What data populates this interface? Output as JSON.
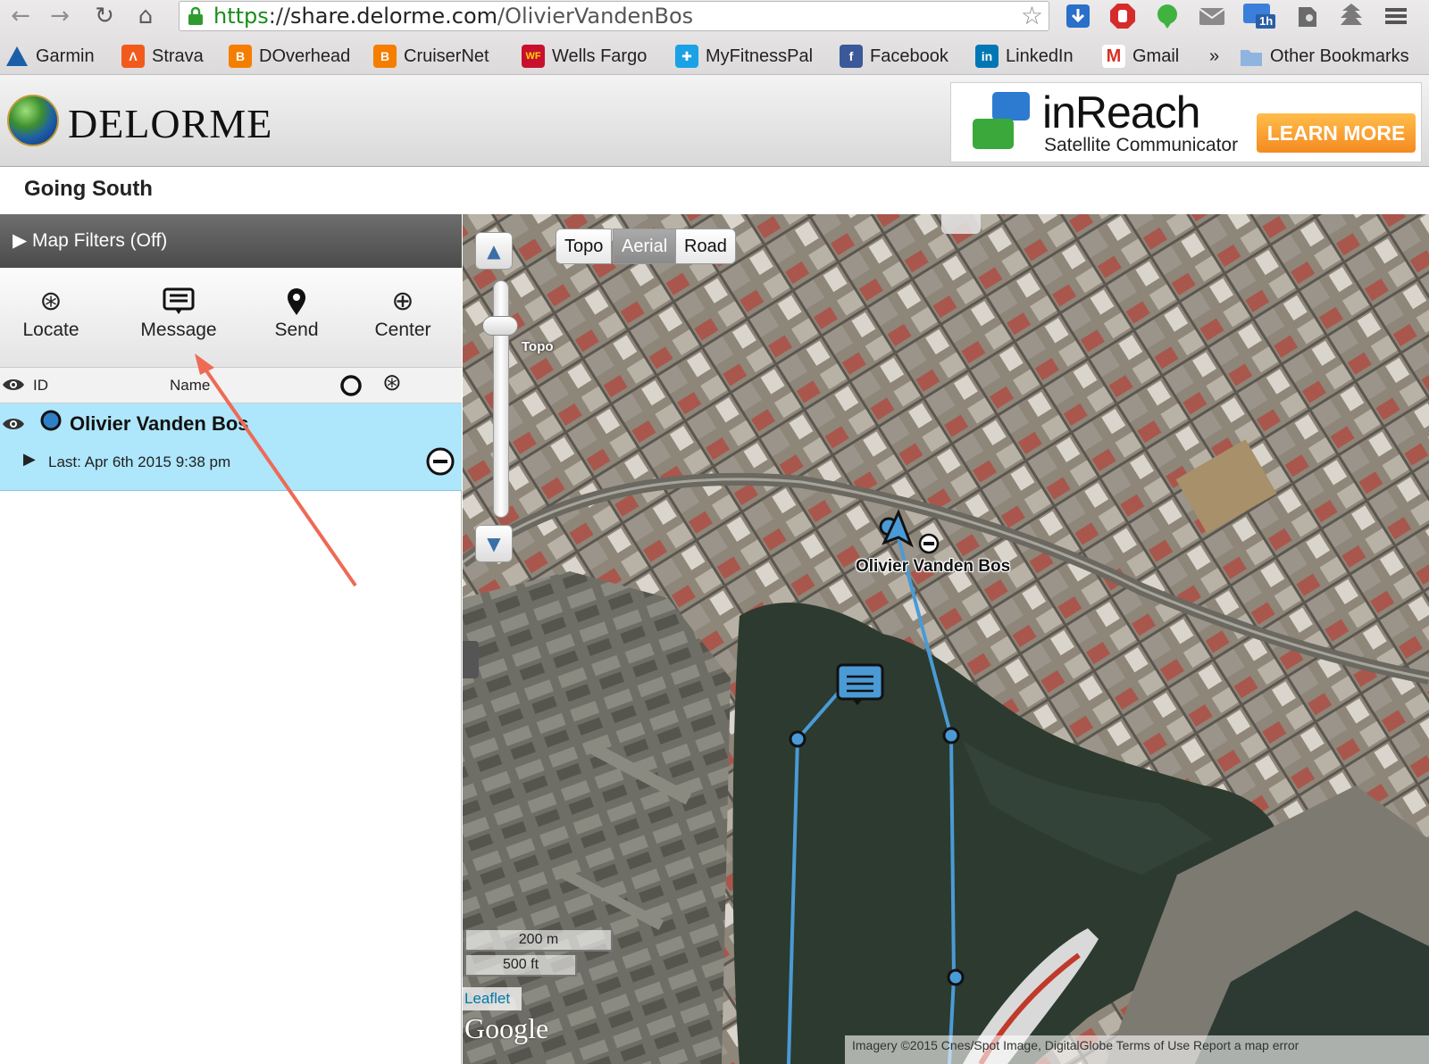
{
  "browser": {
    "url_scheme": "https",
    "url_sep": "://",
    "url_domain": "share.delorme.com",
    "url_path": "/OlivierVandenBos",
    "badge": "1h",
    "bookmarks": [
      {
        "label": "Garmin",
        "icon": "garmin-icon",
        "color": "#1a5fa8"
      },
      {
        "label": "Strava",
        "icon": "strava-icon",
        "color": "#f25a1b"
      },
      {
        "label": "DOverhead",
        "icon": "blogger-icon",
        "color": "#f57d00"
      },
      {
        "label": "CruiserNet",
        "icon": "blogger-icon",
        "color": "#f57d00"
      },
      {
        "label": "Wells Fargo",
        "icon": "wellsfargo-icon",
        "color": "#c8102e"
      },
      {
        "label": "MyFitnessPal",
        "icon": "myfitnesspal-icon",
        "color": "#1aa1e6"
      },
      {
        "label": "Facebook",
        "icon": "facebook-icon",
        "color": "#3b5998"
      },
      {
        "label": "LinkedIn",
        "icon": "linkedin-icon",
        "color": "#0077b5"
      },
      {
        "label": "Gmail",
        "icon": "gmail-icon",
        "color": "#d93025"
      },
      {
        "label": "»",
        "icon": "overflow-icon",
        "color": "#555555"
      },
      {
        "label": "Other Bookmarks",
        "icon": "folder-icon",
        "color": "#8fb4e0"
      }
    ]
  },
  "header": {
    "brand": "DELORME",
    "ad_title": "inReach",
    "ad_subtitle": "Satellite Communicator",
    "ad_button": "LEARN MORE"
  },
  "trip": {
    "title": "Going South"
  },
  "sidebar": {
    "filters_label": "Map Filters (Off)",
    "tools": [
      {
        "label": "Locate",
        "icon": "locate-icon"
      },
      {
        "label": "Message",
        "icon": "message-icon"
      },
      {
        "label": "Send",
        "icon": "pin-icon"
      },
      {
        "label": "Center",
        "icon": "center-icon"
      }
    ],
    "columns": {
      "id": "ID",
      "name": "Name"
    },
    "user": {
      "name": "Olivier Vanden Bos",
      "last": "Last: Apr 6th 2015 9:38 pm"
    }
  },
  "map": {
    "types": [
      "Topo",
      "Aerial",
      "Road"
    ],
    "active_type": "Aerial",
    "zoom_tag": "Topo",
    "marker_label": "Olivier Vanden Bos",
    "scale_metric": "200 m",
    "scale_imperial": "500 ft",
    "leaflet": "Leaflet",
    "google": "Google",
    "attribution": "Imagery ©2015 Cnes/Spot Image, DigitalGlobe   Terms of Use   Report a map error"
  },
  "colors": {
    "track": "#4a9ad6",
    "selected_row": "#aee6fb",
    "annotation_arrow": "#ee6a55"
  }
}
